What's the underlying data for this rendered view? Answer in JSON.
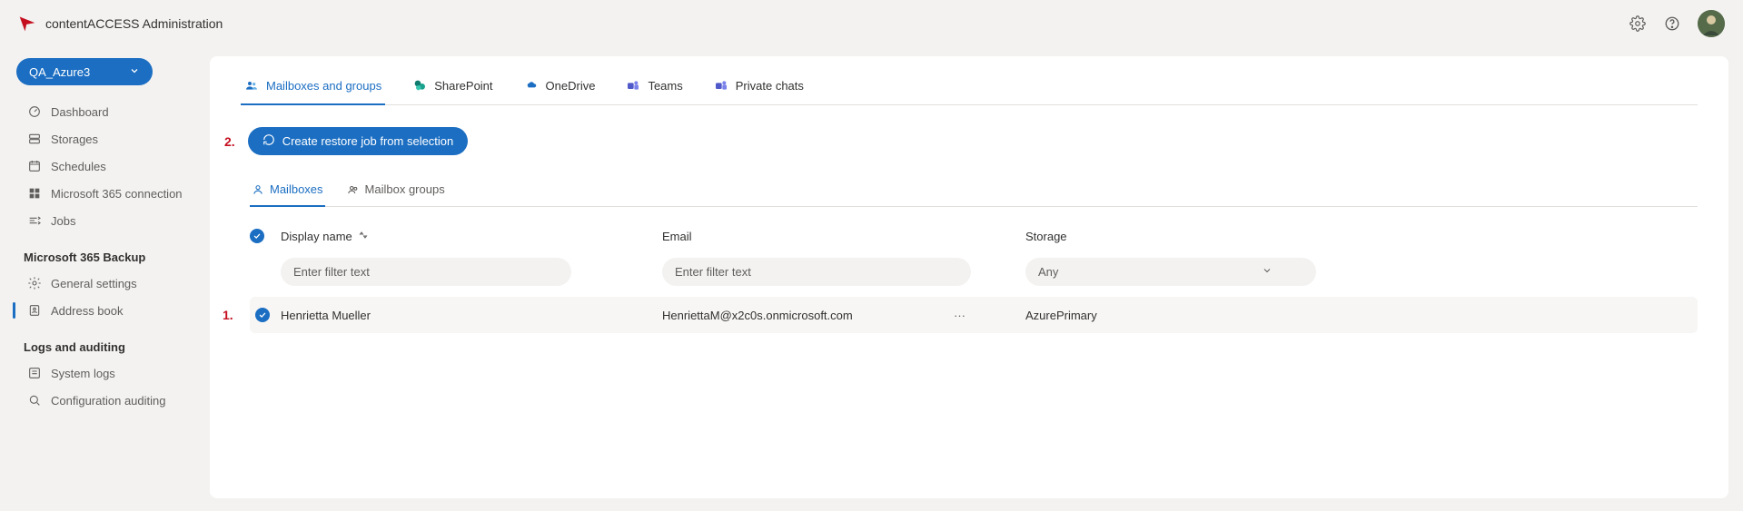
{
  "header": {
    "title": "contentACCESS Administration"
  },
  "tenant": {
    "name": "QA_Azure3"
  },
  "sidebar": {
    "items": [
      {
        "label": "Dashboard"
      },
      {
        "label": "Storages"
      },
      {
        "label": "Schedules"
      },
      {
        "label": "Microsoft 365 connection"
      },
      {
        "label": "Jobs"
      }
    ],
    "section_backup": "Microsoft 365 Backup",
    "backup_items": [
      {
        "label": "General settings"
      },
      {
        "label": "Address book"
      }
    ],
    "section_logs": "Logs and auditing",
    "logs_items": [
      {
        "label": "System logs"
      },
      {
        "label": "Configuration auditing"
      }
    ]
  },
  "top_tabs": [
    {
      "label": "Mailboxes and groups"
    },
    {
      "label": "SharePoint"
    },
    {
      "label": "OneDrive"
    },
    {
      "label": "Teams"
    },
    {
      "label": "Private chats"
    }
  ],
  "annotations": {
    "one": "1.",
    "two": "2."
  },
  "actions": {
    "create_restore": "Create restore job from selection"
  },
  "sub_tabs": [
    {
      "label": "Mailboxes"
    },
    {
      "label": "Mailbox groups"
    }
  ],
  "table": {
    "headers": {
      "display_name": "Display name",
      "email": "Email",
      "storage": "Storage"
    },
    "filters": {
      "name_placeholder": "Enter filter text",
      "email_placeholder": "Enter filter text",
      "storage_selected": "Any"
    },
    "rows": [
      {
        "display_name": "Henrietta Mueller",
        "email": "HenriettaM@x2c0s.onmicrosoft.com",
        "storage": "AzurePrimary"
      }
    ]
  }
}
